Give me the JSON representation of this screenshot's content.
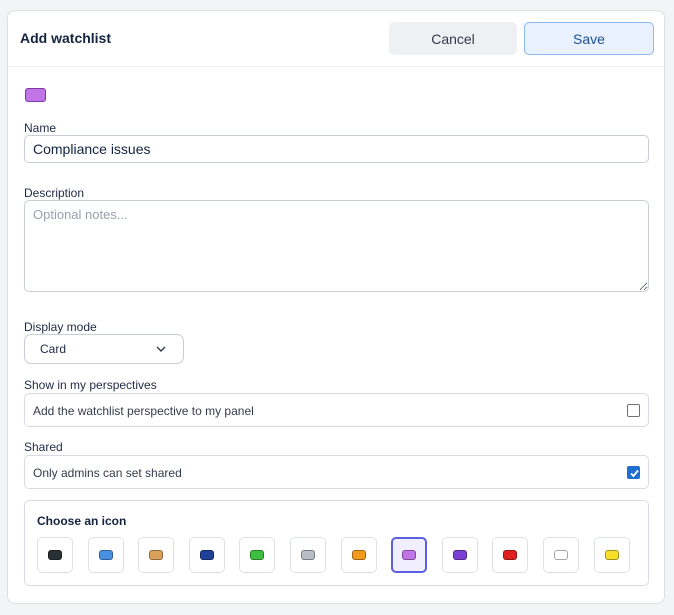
{
  "dialog": {
    "title": "Add watchlist",
    "cancel_label": "Cancel",
    "save_label": "Save",
    "preview_color": "#c074e6"
  },
  "form": {
    "name_label": "Name",
    "name_value": "Compliance issues",
    "description_label": "Description",
    "description_placeholder": "Optional notes...",
    "display_mode_label": "Display mode",
    "display_mode_value": "Card",
    "perspectives_label": "Show in my perspectives",
    "perspectives_option": "Add the watchlist perspective to my panel",
    "perspectives_checked": false,
    "shared_label": "Shared",
    "shared_option": "Only admins can set shared",
    "shared_checked": true
  },
  "icons": {
    "title": "Choose an icon",
    "selected": 7,
    "colors": [
      "#2b2f36",
      "#4a90e2",
      "#d9a15c",
      "#1f3f99",
      "#3fbf3f",
      "#b8bec6",
      "#f39a1e",
      "#c074e6",
      "#7b3fd1",
      "#e0201e",
      "#ffffff",
      "#f6e02a"
    ]
  }
}
